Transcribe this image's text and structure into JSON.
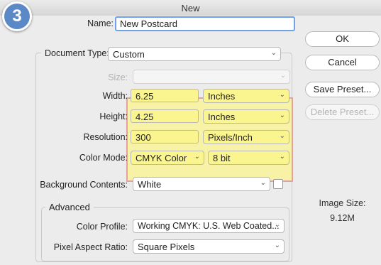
{
  "window": {
    "title": "New"
  },
  "step_badge": "3",
  "name": {
    "label": "Name:",
    "value": "New Postcard"
  },
  "document_type": {
    "label": "Document Type:",
    "value": "Custom"
  },
  "size": {
    "label": "Size:",
    "value": ""
  },
  "width": {
    "label": "Width:",
    "value": "6.25",
    "unit": "Inches"
  },
  "height": {
    "label": "Height:",
    "value": "4.25",
    "unit": "Inches"
  },
  "resolution": {
    "label": "Resolution:",
    "value": "300",
    "unit": "Pixels/Inch"
  },
  "color_mode": {
    "label": "Color Mode:",
    "value": "CMYK Color",
    "depth": "8 bit"
  },
  "background": {
    "label": "Background Contents:",
    "value": "White"
  },
  "advanced": {
    "legend": "Advanced",
    "color_profile": {
      "label": "Color Profile:",
      "value": "Working CMYK:  U.S. Web Coated..."
    },
    "pixel_aspect": {
      "label": "Pixel Aspect Ratio:",
      "value": "Square Pixels"
    }
  },
  "buttons": {
    "ok": "OK",
    "cancel": "Cancel",
    "save_preset": "Save Preset...",
    "delete_preset": "Delete Preset..."
  },
  "image_size": {
    "label": "Image Size:",
    "value": "9.12M"
  },
  "colors": {
    "highlight_fill": "#fbf590",
    "highlight_border": "#e0a2a2",
    "badge": "#5b88c6",
    "focus": "#6fa2e8"
  }
}
